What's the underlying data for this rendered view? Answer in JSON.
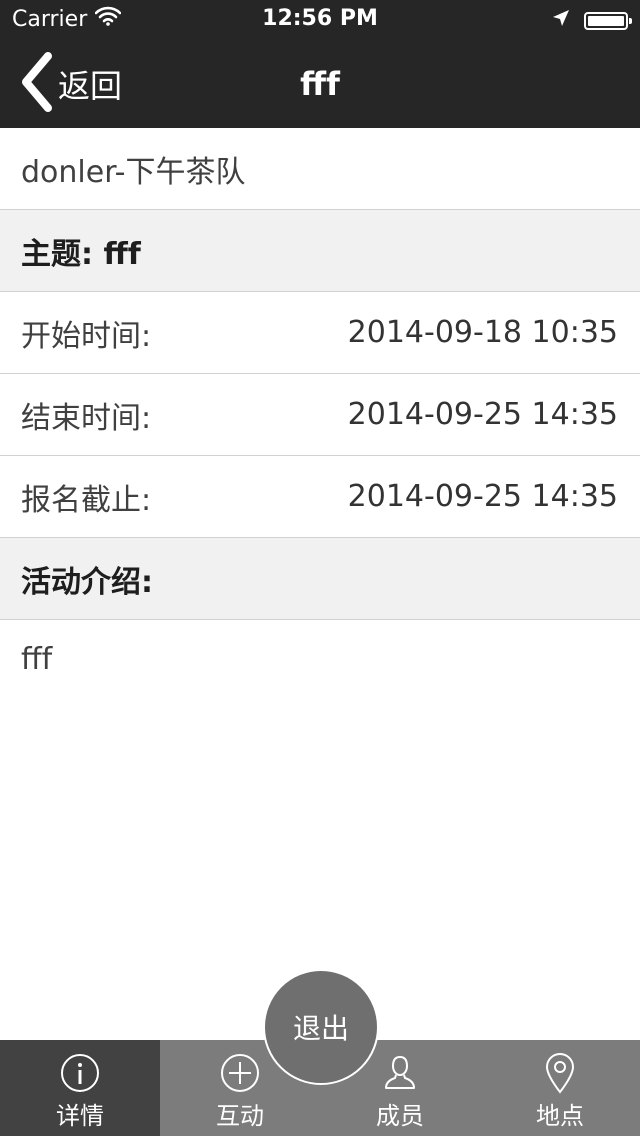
{
  "status_bar": {
    "carrier": "Carrier",
    "time": "12:56 PM",
    "icons": [
      "wifi-icon",
      "location-arrow-icon",
      "battery-icon"
    ]
  },
  "nav": {
    "back_label": "返回",
    "title": "fff"
  },
  "team_name": "donler-下午茶队",
  "topic": "主题: fff",
  "rows": [
    {
      "label": "开始时间:",
      "value": "2014-09-18 10:35"
    },
    {
      "label": "结束时间:",
      "value": "2014-09-25 14:35"
    },
    {
      "label": "报名截止:",
      "value": "2014-09-25 14:35"
    }
  ],
  "intro": {
    "heading": "活动介绍:",
    "text": "fff"
  },
  "exit_button": "退出",
  "tabs": [
    {
      "label": "详情",
      "icon": "info-icon",
      "active": true
    },
    {
      "label": "互动",
      "icon": "plus-circle-icon",
      "active": false
    },
    {
      "label": "成员",
      "icon": "person-icon",
      "active": false
    },
    {
      "label": "地点",
      "icon": "map-pin-icon",
      "active": false
    }
  ],
  "colors": {
    "nav_background": "#262626",
    "tab_bar": "#7c7c7c",
    "tab_active": "#424242",
    "section_gray": "#f1f1f1",
    "exit_button": "#6f6f6f"
  }
}
